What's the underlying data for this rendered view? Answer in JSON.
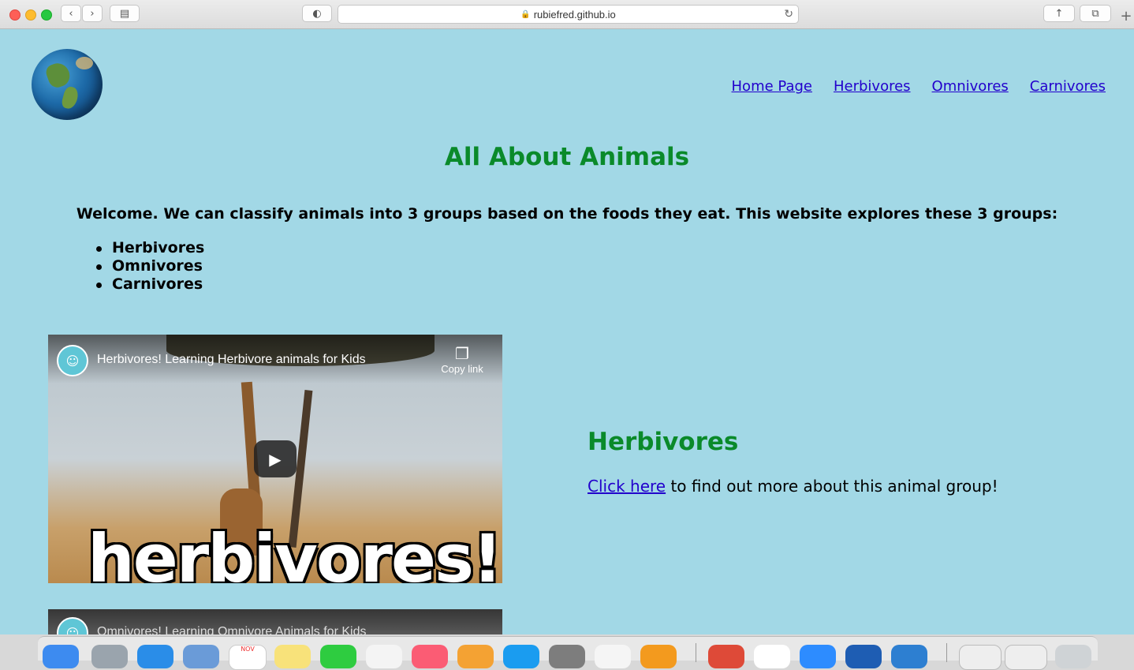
{
  "browser": {
    "url": "rubiefred.github.io",
    "icons": [
      "back-icon",
      "forward-icon",
      "sidebar-icon",
      "shield-icon",
      "lock-icon",
      "reload-icon",
      "share-icon",
      "tabs-icon",
      "new-tab-icon"
    ]
  },
  "nav": {
    "items": [
      {
        "label": "Home Page"
      },
      {
        "label": "Herbivores"
      },
      {
        "label": "Omnivores"
      },
      {
        "label": "Carnivores"
      }
    ]
  },
  "main": {
    "title": "All About Animals",
    "welcome": "Welcome. We can classify animals into 3 groups based on the foods they eat. This website explores these 3 groups:",
    "groups": [
      "Herbivores",
      "Omnivores",
      "Carnivores"
    ]
  },
  "videos": [
    {
      "title": "Herbivores! Learning Herbivore animals for Kids",
      "copy_label": "Copy link",
      "thumb_text": "herbivores!"
    },
    {
      "title": "Omnivores! Learning Omnivore Animals for Kids"
    }
  ],
  "section": {
    "title": "Herbivores",
    "link_label": "Click here",
    "text_after": " to find out more about this animal group!"
  },
  "colors": {
    "page_bg": "#a2d8e6",
    "heading_green": "#0a8a2a",
    "link_blue": "#2200cc"
  },
  "dock": {
    "icons": [
      "finder-icon",
      "launchpad-icon",
      "safari-icon",
      "preview-icon",
      "calendar-icon",
      "notes-icon",
      "facetime-icon",
      "photos-icon",
      "music-icon",
      "pages-icon",
      "app-store-icon",
      "system-preferences-icon",
      "news-icon",
      "books-icon",
      "chrome-icon",
      "slack-icon",
      "zoom-icon",
      "word-icon",
      "vscode-icon",
      "trash-icon"
    ],
    "calendar_month": "NOV"
  }
}
